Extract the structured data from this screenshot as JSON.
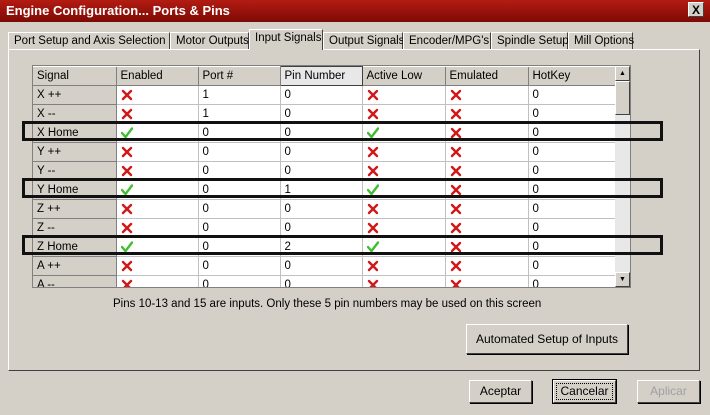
{
  "window": {
    "title": "Engine Configuration... Ports & Pins",
    "close_label": "X"
  },
  "tabs": [
    {
      "label": "Port Setup and Axis Selection",
      "active": false
    },
    {
      "label": "Motor Outputs",
      "active": false
    },
    {
      "label": "Input Signals",
      "active": true
    },
    {
      "label": "Output Signals",
      "active": false
    },
    {
      "label": "Encoder/MPG's",
      "active": false
    },
    {
      "label": "Spindle Setup",
      "active": false
    },
    {
      "label": "Mill Options",
      "active": false
    }
  ],
  "grid": {
    "columns": [
      "Signal",
      "Enabled",
      "Port #",
      "Pin Number",
      "Active Low",
      "Emulated",
      "HotKey"
    ],
    "rows": [
      {
        "signal": "X ++",
        "enabled": "no",
        "port": "1",
        "pin": "0",
        "active_low": "no",
        "emulated": "no",
        "hotkey": "0"
      },
      {
        "signal": "X --",
        "enabled": "no",
        "port": "1",
        "pin": "0",
        "active_low": "no",
        "emulated": "no",
        "hotkey": "0"
      },
      {
        "signal": "X Home",
        "enabled": "yes",
        "port": "0",
        "pin": "0",
        "active_low": "yes",
        "emulated": "no",
        "hotkey": "0"
      },
      {
        "signal": "Y ++",
        "enabled": "no",
        "port": "0",
        "pin": "0",
        "active_low": "no",
        "emulated": "no",
        "hotkey": "0"
      },
      {
        "signal": "Y --",
        "enabled": "no",
        "port": "0",
        "pin": "0",
        "active_low": "no",
        "emulated": "no",
        "hotkey": "0"
      },
      {
        "signal": "Y Home",
        "enabled": "yes",
        "port": "0",
        "pin": "1",
        "active_low": "yes",
        "emulated": "no",
        "hotkey": "0"
      },
      {
        "signal": "Z ++",
        "enabled": "no",
        "port": "0",
        "pin": "0",
        "active_low": "no",
        "emulated": "no",
        "hotkey": "0"
      },
      {
        "signal": "Z --",
        "enabled": "no",
        "port": "0",
        "pin": "0",
        "active_low": "no",
        "emulated": "no",
        "hotkey": "0"
      },
      {
        "signal": "Z Home",
        "enabled": "yes",
        "port": "0",
        "pin": "2",
        "active_low": "yes",
        "emulated": "no",
        "hotkey": "0"
      },
      {
        "signal": "A ++",
        "enabled": "no",
        "port": "0",
        "pin": "0",
        "active_low": "no",
        "emulated": "no",
        "hotkey": "0"
      },
      {
        "signal": "A --",
        "enabled": "no",
        "port": "0",
        "pin": "0",
        "active_low": "no",
        "emulated": "no",
        "hotkey": "0"
      }
    ]
  },
  "note": "Pins 10-13 and 15 are inputs. Only these 5 pin numbers may be used on this screen",
  "buttons": {
    "auto_setup": "Automated Setup of Inputs",
    "accept": "Aceptar",
    "cancel": "Cancelar",
    "apply": "Aplicar"
  },
  "colors": {
    "title_bar": "#b31c12",
    "check_green": "#3fbf2f",
    "cross_red": "#d01818"
  }
}
